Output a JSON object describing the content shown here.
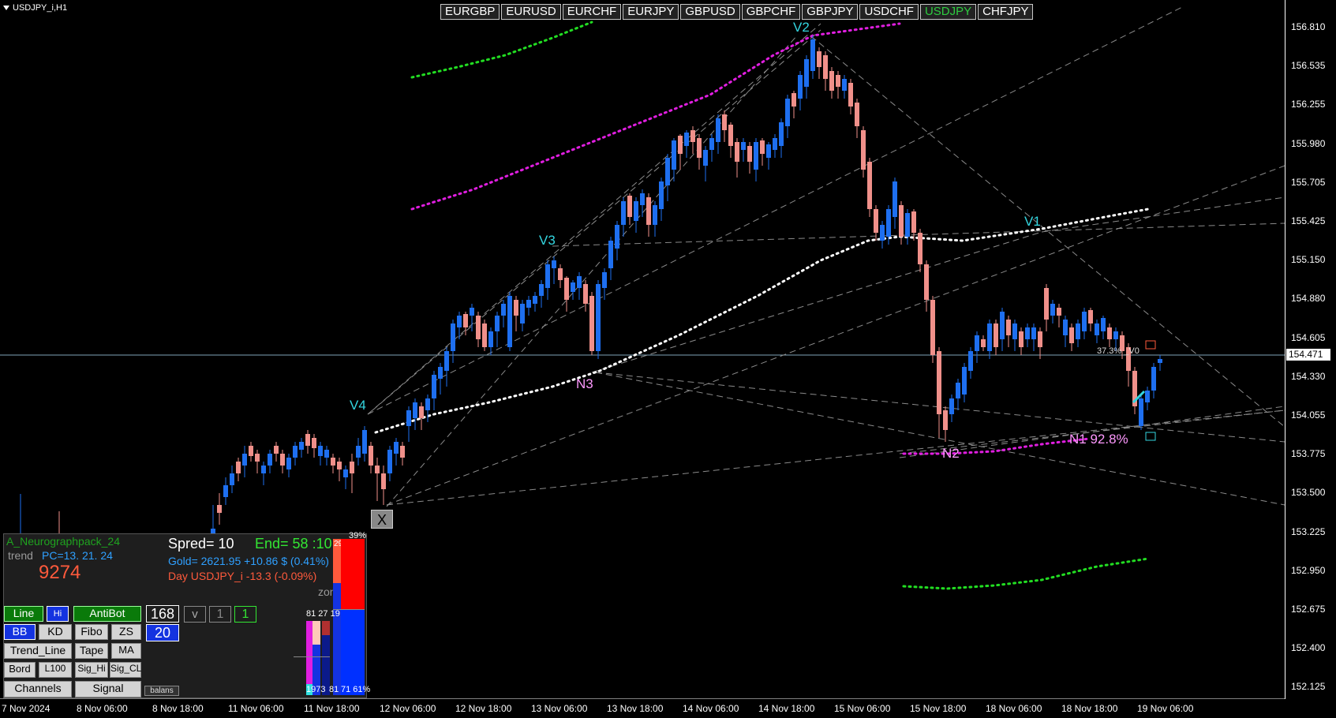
{
  "window": {
    "title": "USDJPY_i,H1"
  },
  "symbols": [
    "EURGBP",
    "EURUSD",
    "EURCHF",
    "EURJPY",
    "GBPUSD",
    "GBPCHF",
    "GBPJPY",
    "USDCHF",
    "USDJPY",
    "CHFJPY"
  ],
  "active_symbol": "USDJPY",
  "price_axis": [
    "156.810",
    "156.535",
    "156.255",
    "155.980",
    "155.705",
    "155.425",
    "155.150",
    "154.880",
    "154.605",
    "154.330",
    "154.055",
    "153.775",
    "153.500",
    "153.225",
    "152.950",
    "152.675",
    "152.400",
    "152.125"
  ],
  "current_price": "154.471",
  "time_axis": [
    "7 Nov 2024",
    "8 Nov 06:00",
    "8 Nov 18:00",
    "11 Nov 06:00",
    "11 Nov 18:00",
    "12 Nov 06:00",
    "12 Nov 18:00",
    "13 Nov 06:00",
    "13 Nov 18:00",
    "14 Nov 06:00",
    "14 Nov 18:00",
    "15 Nov 06:00",
    "15 Nov 18:00",
    "18 Nov 06:00",
    "18 Nov 18:00",
    "19 Nov 06:00"
  ],
  "markers": {
    "v1": "V1",
    "v2": "V2",
    "v3": "V3",
    "v4": "V4",
    "n1": "N1 92.8%",
    "n2": "N2",
    "n3": "N3",
    "fib_label": "37.3% _V0"
  },
  "colors": {
    "bull": "#1e6ff0",
    "bear": "#f0908a",
    "marker": "#33d6e0",
    "pink": "#ff99ff",
    "magenta_dots": "#e01ee0",
    "green_dots": "#22dd22",
    "white_dots": "#ffffff",
    "grid_dash": "#8a8a8a"
  },
  "panel": {
    "name": "A_Neurographpack_24",
    "trend_label": "trend",
    "pc": "PC=13. 21. 24",
    "big_number": "9274",
    "spread": "Spred= 10",
    "end": "End= 58 :10",
    "gold": "Gold= 2621.95 +10.86 $ (0.41%)",
    "day": "Day USDJPY_i   -13.3 (-0.09%)",
    "zone": "zon= 3",
    "buttons": {
      "line": "Line",
      "hi": "Hi",
      "antibot": "AntiBot",
      "bb": "BB",
      "kd": "KD",
      "fibo": "Fibo",
      "zs": "ZS",
      "trend_line": "Trend_Line",
      "tape": "Tape",
      "ma": "MA",
      "bord": "Bord",
      "l100": "L100",
      "sig_hi": "Sig_Hi",
      "sig_cl": "Sig_CL",
      "channels": "Channels",
      "signal": "Signal",
      "balans": "balans"
    },
    "num168": "168",
    "v_label": "v",
    "one_a": "1",
    "one_b": "1",
    "num20": "20",
    "close_x": "X",
    "bars": {
      "pct_top": "39%",
      "top_num": "29",
      "small_labels": "81 27 19",
      "bottom_left": "1973",
      "bottom_mid": "81",
      "bottom_right": "71 61%"
    }
  }
}
